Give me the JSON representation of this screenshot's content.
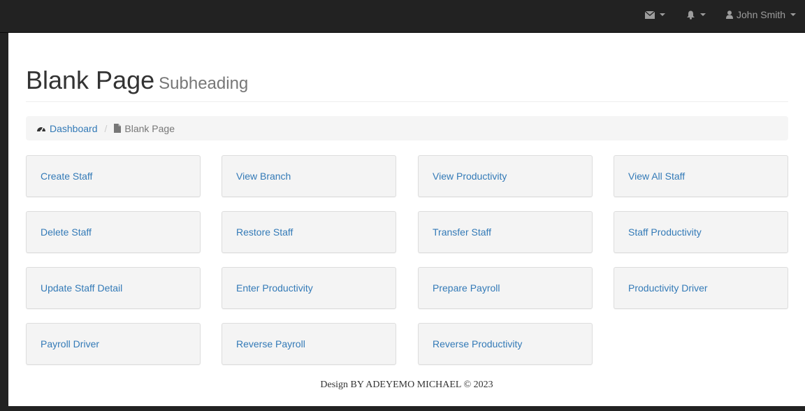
{
  "navbar": {
    "user_name": "John Smith",
    "icons": [
      "envelope-icon",
      "bell-icon",
      "user-icon"
    ]
  },
  "page": {
    "title": "Blank Page",
    "subtitle": "Subheading"
  },
  "breadcrumb": {
    "items": [
      {
        "label": "Dashboard",
        "icon": "dashboard-icon"
      },
      {
        "label": "Blank Page",
        "icon": "file-icon"
      }
    ]
  },
  "tiles": [
    {
      "label": "Create Staff"
    },
    {
      "label": "View Branch"
    },
    {
      "label": "View Productivity"
    },
    {
      "label": "View All Staff"
    },
    {
      "label": "Delete Staff"
    },
    {
      "label": "Restore Staff"
    },
    {
      "label": "Transfer Staff"
    },
    {
      "label": "Staff Productivity"
    },
    {
      "label": "Update Staff Detail"
    },
    {
      "label": "Enter Productivity"
    },
    {
      "label": "Prepare Payroll"
    },
    {
      "label": "Productivity Driver"
    },
    {
      "label": "Payroll Driver"
    },
    {
      "label": "Reverse Payroll"
    },
    {
      "label": "Reverse Productivity"
    }
  ],
  "footer": {
    "text": "Design BY ADEYEMO MICHAEL © 2023"
  }
}
